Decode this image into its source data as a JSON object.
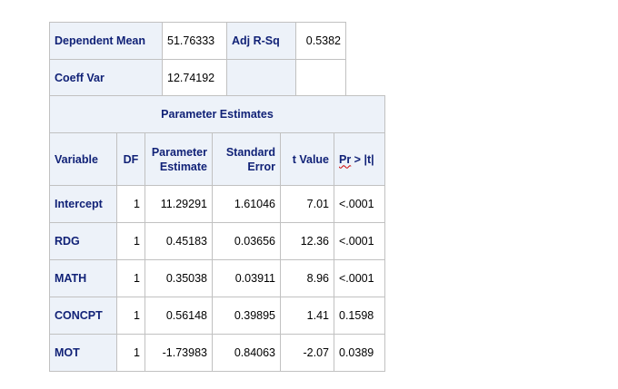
{
  "fit_stats": {
    "dep_mean_label": "Dependent Mean",
    "dep_mean_value": "51.76333",
    "adj_rsq_label": "Adj R-Sq",
    "adj_rsq_value": "0.5382",
    "coeff_var_label": "Coeff Var",
    "coeff_var_value": "12.74192"
  },
  "parameter_estimates": {
    "title": "Parameter Estimates",
    "columns": {
      "variable": "Variable",
      "df": "DF",
      "estimate_1": "Parameter",
      "estimate_2": "Estimate",
      "stderr_1": "Standard",
      "stderr_2": "Error",
      "tvalue": "t Value",
      "pr_1": "Pr",
      "pr_2": " > |t|"
    },
    "rows": [
      {
        "variable": "Intercept",
        "df": "1",
        "estimate": "11.29291",
        "stderr": "1.61046",
        "tvalue": "7.01",
        "pr": "<.0001"
      },
      {
        "variable": "RDG",
        "df": "1",
        "estimate": "0.45183",
        "stderr": "0.03656",
        "tvalue": "12.36",
        "pr": "<.0001"
      },
      {
        "variable": "MATH",
        "df": "1",
        "estimate": "0.35038",
        "stderr": "0.03911",
        "tvalue": "8.96",
        "pr": "<.0001"
      },
      {
        "variable": "CONCPT",
        "df": "1",
        "estimate": "0.56148",
        "stderr": "0.39895",
        "tvalue": "1.41",
        "pr": "0.1598"
      },
      {
        "variable": "MOT",
        "df": "1",
        "estimate": "-1.73983",
        "stderr": "0.84063",
        "tvalue": "-2.07",
        "pr": "0.0389"
      }
    ]
  }
}
